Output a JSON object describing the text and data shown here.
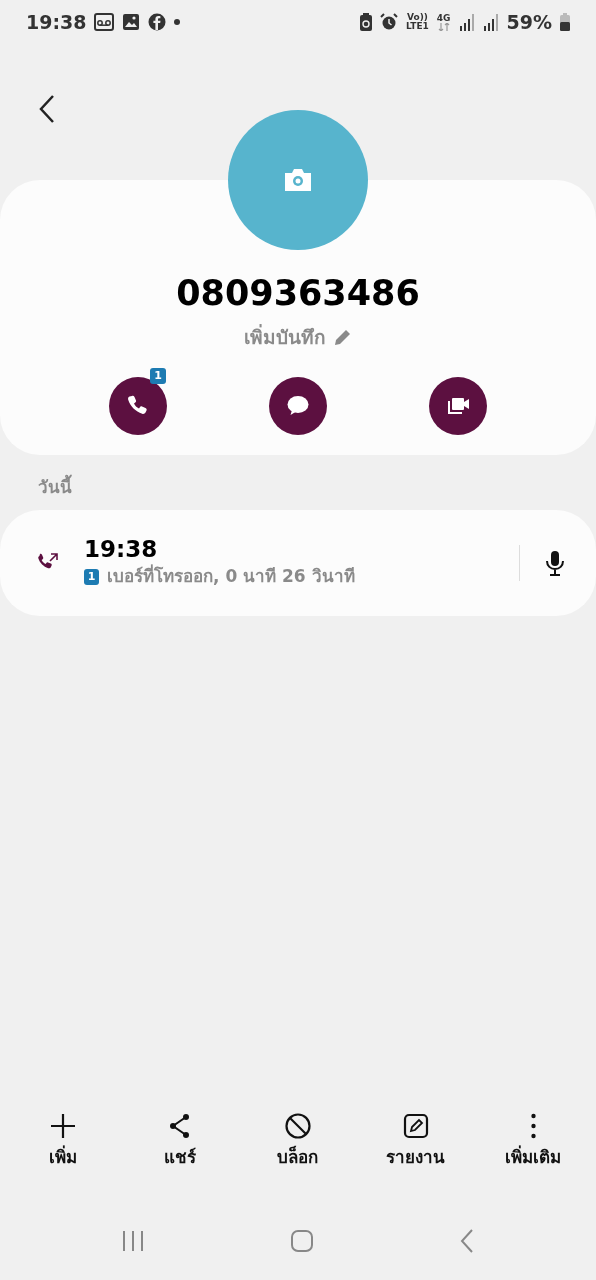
{
  "status_bar": {
    "time": "19:38",
    "volte": "Vo))",
    "lte": "LTE1",
    "network": "4G",
    "battery": "59%"
  },
  "contact": {
    "number": "0809363486",
    "note": "เพิ่มบันทึก"
  },
  "quick_actions": [
    {
      "kind": "call",
      "badge": "1"
    },
    {
      "kind": "message"
    },
    {
      "kind": "video"
    }
  ],
  "history": {
    "heading": "วันนี้",
    "calls": [
      {
        "time": "19:38",
        "sim": "1",
        "detail": "เบอร์ที่โทรออก, 0 นาที 26 วินาที"
      }
    ]
  },
  "toolbar": [
    {
      "label": "เพิ่ม"
    },
    {
      "label": "แชร์"
    },
    {
      "label": "บล็อก"
    },
    {
      "label": "รายงาน"
    },
    {
      "label": "เพิ่มเติม"
    }
  ]
}
